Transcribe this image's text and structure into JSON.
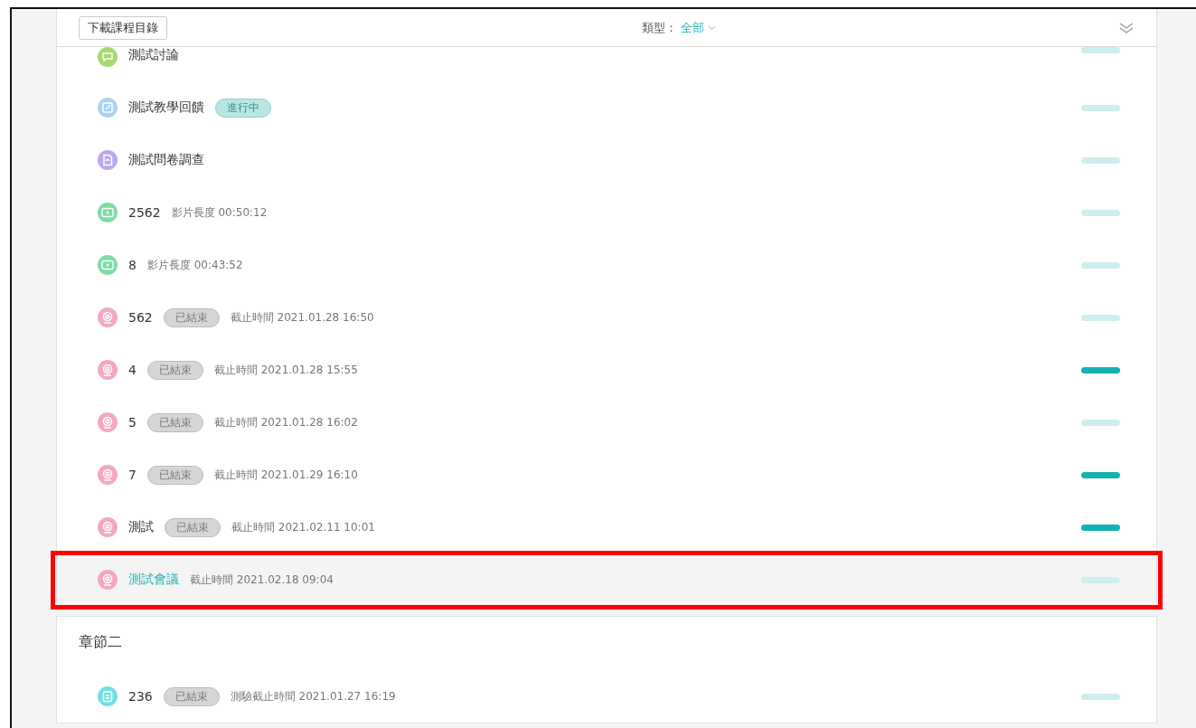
{
  "toolbar": {
    "download_button": "下載課程目錄",
    "filter_label": "類型：",
    "filter_value": "全部"
  },
  "chapters": [
    {
      "items": [
        {
          "kind": "discussion",
          "title": "測試討論",
          "completed": false,
          "selected": false
        },
        {
          "kind": "feedback",
          "title": "測試教學回饋",
          "status": {
            "kind": "ongoing",
            "label": "進行中"
          },
          "completed": false,
          "selected": false
        },
        {
          "kind": "survey",
          "title": "測試問卷調查",
          "completed": false,
          "selected": false
        },
        {
          "kind": "video",
          "title": "2562",
          "meta": "影片長度 00:50:12",
          "completed": false,
          "selected": false
        },
        {
          "kind": "video",
          "title": "8",
          "meta": "影片長度 00:43:52",
          "completed": false,
          "selected": false
        },
        {
          "kind": "meeting",
          "title": "562",
          "status": {
            "kind": "ended",
            "label": "已結束"
          },
          "meta": "截止時間 2021.01.28 16:50",
          "completed": false,
          "selected": false
        },
        {
          "kind": "meeting",
          "title": "4",
          "status": {
            "kind": "ended",
            "label": "已結束"
          },
          "meta": "截止時間 2021.01.28 15:55",
          "completed": true,
          "selected": false
        },
        {
          "kind": "meeting",
          "title": "5",
          "status": {
            "kind": "ended",
            "label": "已結束"
          },
          "meta": "截止時間 2021.01.28 16:02",
          "completed": false,
          "selected": false
        },
        {
          "kind": "meeting",
          "title": "7",
          "status": {
            "kind": "ended",
            "label": "已結束"
          },
          "meta": "截止時間 2021.01.29 16:10",
          "completed": true,
          "selected": false
        },
        {
          "kind": "meeting",
          "title": "測試",
          "status": {
            "kind": "ended",
            "label": "已結束"
          },
          "meta": "截止時間 2021.02.11 10:01",
          "completed": true,
          "selected": false
        },
        {
          "kind": "meeting",
          "title": "測試會議",
          "meta": "截止時間 2021.02.18 09:04",
          "completed": false,
          "selected": true,
          "highlighted": true
        }
      ]
    },
    {
      "title": "章節二",
      "items": [
        {
          "kind": "quiz",
          "title": "236",
          "status": {
            "kind": "ended",
            "label": "已結束"
          },
          "meta": "測驗截止時間 2021.01.27 16:19",
          "completed": false,
          "selected": false
        }
      ]
    }
  ]
}
